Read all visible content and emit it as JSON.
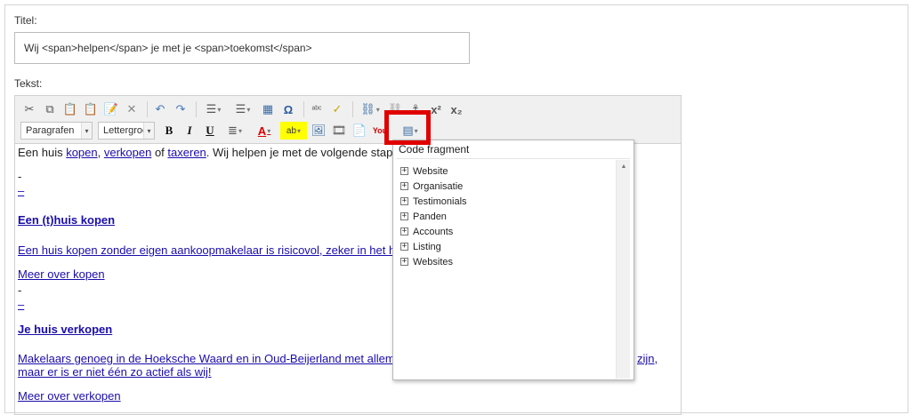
{
  "form": {
    "title_label": "Titel:",
    "title_value": "Wij <span>helpen</span> je met je <span>toekomst</span>",
    "text_label": "Tekst:"
  },
  "toolbar": {
    "row1_icons": [
      "cut-icon",
      "copy-icon",
      "paste-icon",
      "paste-text-icon",
      "paste-word-icon",
      "remove-format-icon",
      "undo-icon",
      "redo-icon",
      "numbered-list-icon",
      "bulleted-list-icon",
      "table-icon",
      "special-char-icon",
      "spellcheck-icon",
      "check-icon",
      "link-icon",
      "unlink-icon",
      "anchor-icon",
      "superscript-icon",
      "subscript-icon"
    ],
    "paragraph_combo": "Paragrafen",
    "font_combo": "Lettergrootte",
    "bold": "B",
    "italic": "I",
    "underline": "U",
    "omega": "Ω"
  },
  "content": {
    "intro_prefix": "Een huis ",
    "link_kopen": "kopen",
    "comma": ", ",
    "link_verkopen": "verkopen",
    "of": " of ",
    "link_taxeren": "taxeren",
    "intro_suffix": ". Wij helpen je met de volgende stap",
    "dash1": "-",
    "dash2": "–",
    "heading1": "Een (t)huis kopen",
    "para1": "Een huis kopen zonder eigen aankoopmakelaar is risicovol, zeker in het h",
    "more1": "Meer over kopen ",
    "dash3": "-",
    "dash4": "–",
    "heading2": "Je huis verkopen",
    "para2a": "Makelaars genoeg in de Hoeksche Waard en in Oud-Beijerland met allem",
    "para2a_tail": "zijn, ",
    "para2b": "maar er is er niet één zo actief als wij!",
    "more2": "Meer over verkopen"
  },
  "popup": {
    "title": "Code fragment",
    "items": [
      "Website",
      "Organisatie",
      "Testimonials",
      "Panden",
      "Accounts",
      "Listing",
      "Websites"
    ]
  }
}
